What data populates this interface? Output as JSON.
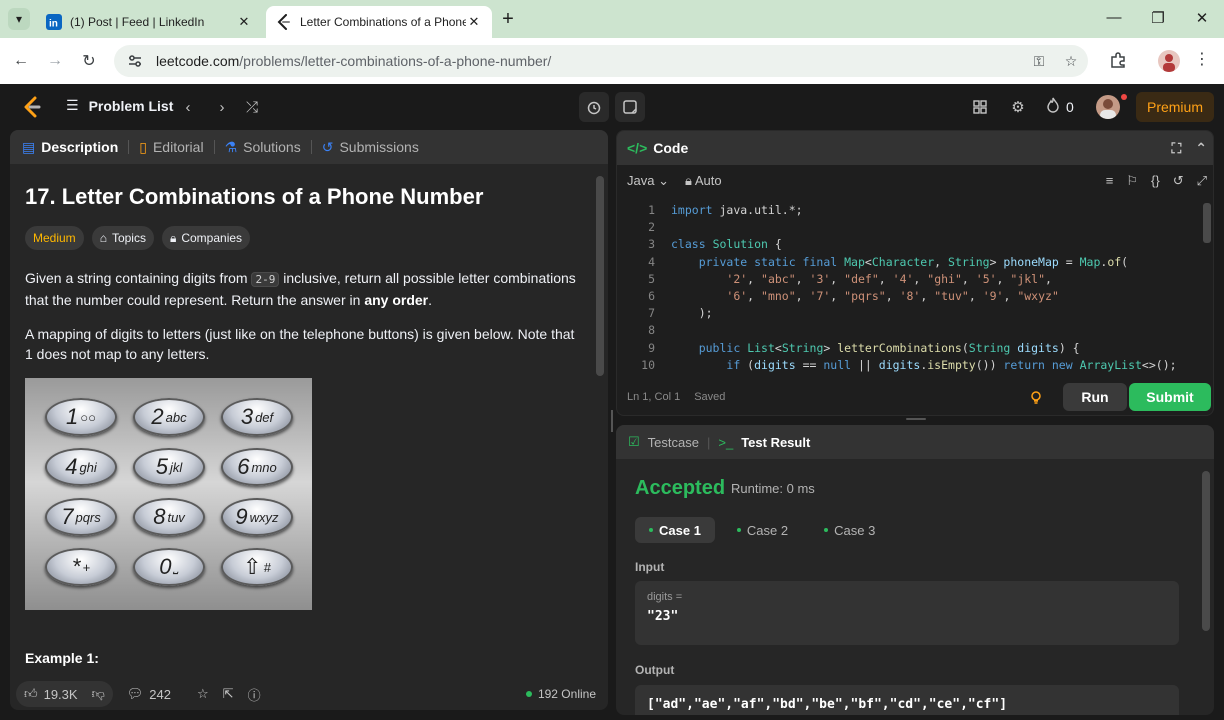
{
  "browser": {
    "tabs": [
      {
        "title": "(1) Post | Feed | LinkedIn",
        "active": false
      },
      {
        "title": "Letter Combinations of a Phone Number",
        "active": true
      }
    ],
    "url_host": "leetcode.com",
    "url_path": "/problems/letter-combinations-of-a-phone-number/"
  },
  "header": {
    "problem_list": "Problem List",
    "streak_count": "0",
    "premium": "Premium"
  },
  "left": {
    "tabs": [
      "Description",
      "Editorial",
      "Solutions",
      "Submissions"
    ],
    "title": "17. Letter Combinations of a Phone Number",
    "difficulty": "Medium",
    "topics": "Topics",
    "companies": "Companies",
    "desc1_a": "Given a string containing digits from ",
    "desc1_code": "2-9",
    "desc1_b": " inclusive, return all possible letter combinations that the number could represent. Return the answer in ",
    "desc1_bold": "any order",
    "desc1_c": ".",
    "desc2": "A mapping of digits to letters (just like on the telephone buttons) is given below. Note that 1 does not map to any letters.",
    "keys": [
      {
        "d": "1",
        "l": "○○"
      },
      {
        "d": "2",
        "l": "abc"
      },
      {
        "d": "3",
        "l": "def"
      },
      {
        "d": "4",
        "l": "ghi"
      },
      {
        "d": "5",
        "l": "jkl"
      },
      {
        "d": "6",
        "l": "mno"
      },
      {
        "d": "7",
        "l": "pqrs"
      },
      {
        "d": "8",
        "l": "tuv"
      },
      {
        "d": "9",
        "l": "wxyz"
      },
      {
        "d": "*",
        "l": "+"
      },
      {
        "d": "0",
        "l": "⎵"
      },
      {
        "d": "⇧",
        "l": "#"
      }
    ],
    "example": "Example 1:",
    "likes": "19.3K",
    "comments": "242",
    "online": "192 Online"
  },
  "code": {
    "title": "Code",
    "language": "Java",
    "auto": "Auto",
    "status_pos": "Ln 1, Col 1",
    "status_saved": "Saved",
    "run": "Run",
    "submit": "Submit",
    "line_numbers": [
      "1",
      "2",
      "3",
      "4",
      "5",
      "6",
      "7",
      "8",
      "9",
      "10"
    ]
  },
  "result": {
    "testcase_tab": "Testcase",
    "result_tab": "Test Result",
    "status": "Accepted",
    "runtime": "Runtime: 0 ms",
    "cases": [
      "Case 1",
      "Case 2",
      "Case 3"
    ],
    "input_label": "Input",
    "input_key": "digits =",
    "input_value": "\"23\"",
    "output_label": "Output",
    "output_value": "[\"ad\",\"ae\",\"af\",\"bd\",\"be\",\"bf\",\"cd\",\"ce\",\"cf\"]"
  }
}
